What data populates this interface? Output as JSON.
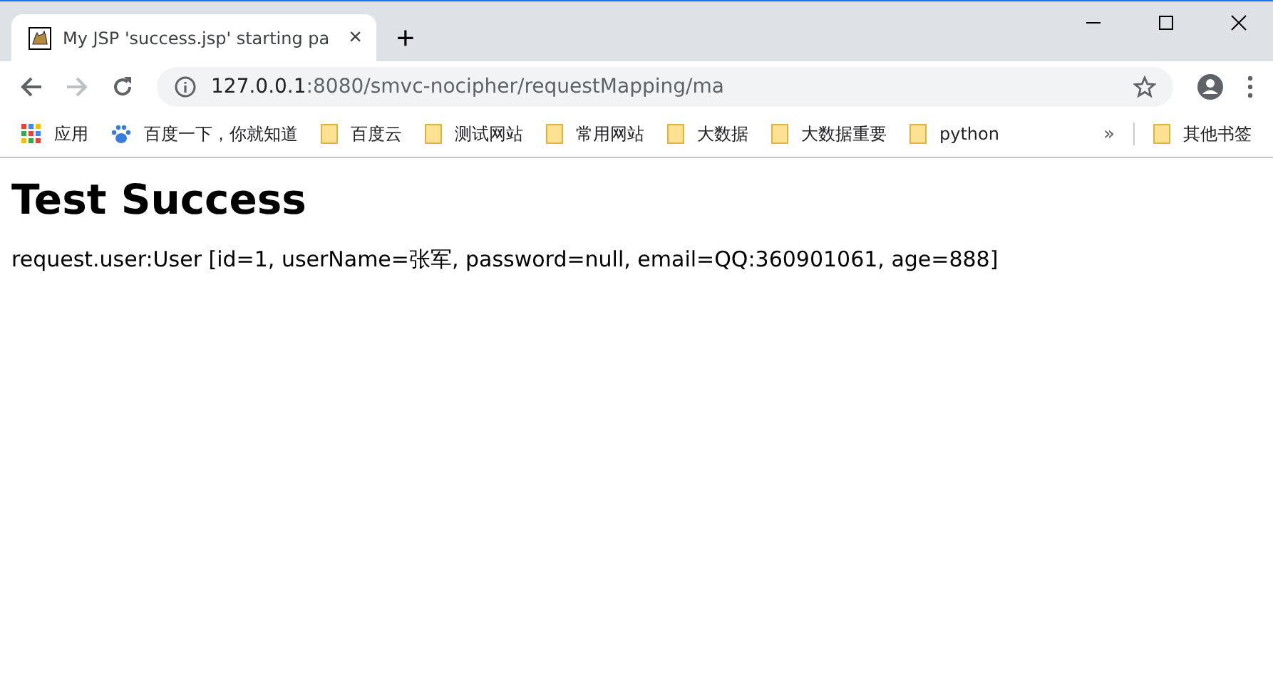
{
  "tab": {
    "title": "My JSP 'success.jsp' starting pa",
    "close": "×"
  },
  "new_tab": "+",
  "address_bar": {
    "host": "127.0.0.1",
    "path": ":8080/smvc-nocipher/requestMapping/ma"
  },
  "bookmarks": [
    {
      "kind": "apps",
      "label": "应用"
    },
    {
      "kind": "paw",
      "label": "百度一下，你就知道"
    },
    {
      "kind": "folder",
      "label": "百度云"
    },
    {
      "kind": "folder",
      "label": "测试网站"
    },
    {
      "kind": "folder",
      "label": "常用网站"
    },
    {
      "kind": "folder",
      "label": "大数据"
    },
    {
      "kind": "folder",
      "label": "大数据重要"
    },
    {
      "kind": "folder",
      "label": "python"
    }
  ],
  "bookmarks_overflow": "»",
  "other_bookmarks": "其他书签",
  "page": {
    "heading": "Test Success",
    "text": "request.user:User [id=1, userName=张军, password=null, email=QQ:360901061, age=888]"
  }
}
